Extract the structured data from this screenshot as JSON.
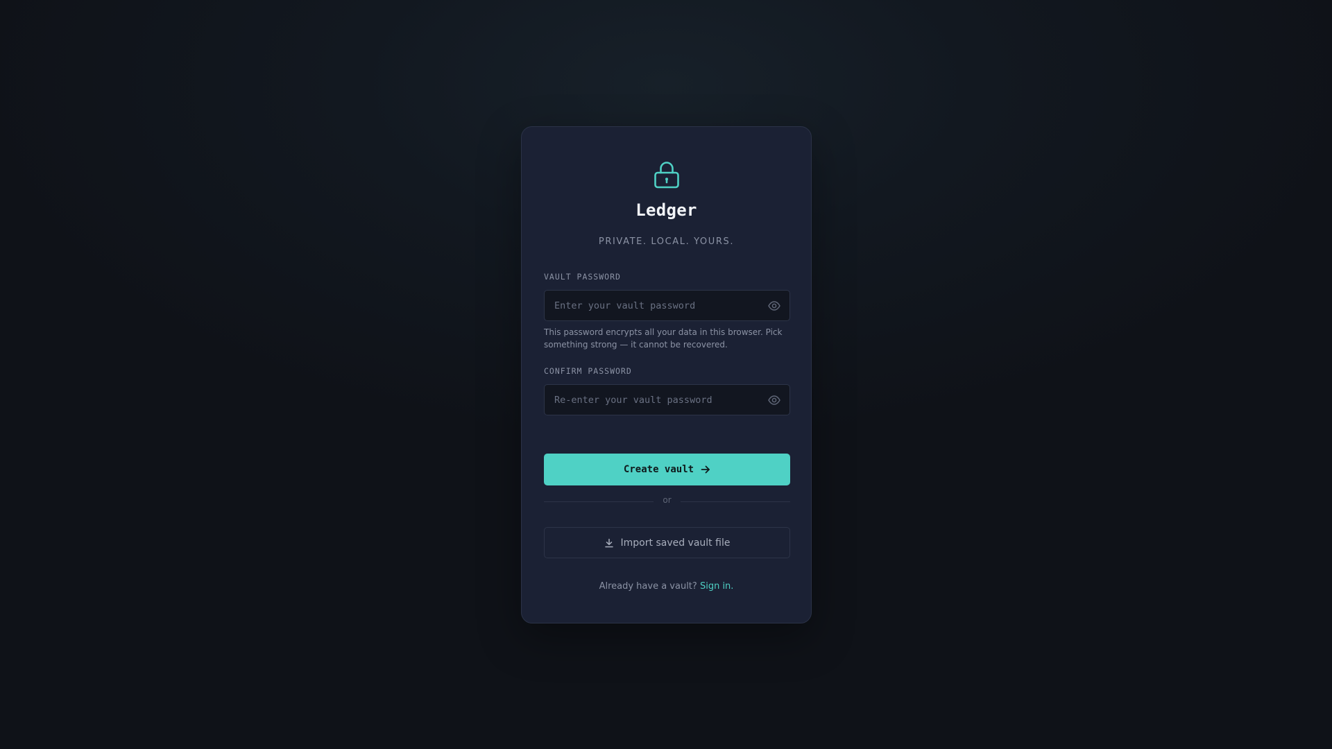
{
  "app": {
    "title": "Ledger",
    "tagline": "PRIVATE. LOCAL. YOURS.",
    "icon": "lock-icon",
    "accent_color": "#4fd1c5"
  },
  "form": {
    "vault_password": {
      "label": "VAULT PASSWORD",
      "value": "",
      "placeholder": "Enter your vault password",
      "toggle_icon": "eye-icon"
    },
    "hint": "This password encrypts all your data in this browser. Pick something strong — it cannot be recovered.",
    "confirm_password": {
      "label": "CONFIRM PASSWORD",
      "value": "",
      "placeholder": "Re-enter your vault password",
      "toggle_icon": "eye-icon"
    }
  },
  "actions": {
    "create_label": "Create vault",
    "create_icon": "arrow-right-icon",
    "divider_text": "or",
    "import_label": "Import saved vault file",
    "import_icon": "download-icon"
  },
  "footer": {
    "text": "Already have a vault?",
    "link": "Sign in."
  }
}
